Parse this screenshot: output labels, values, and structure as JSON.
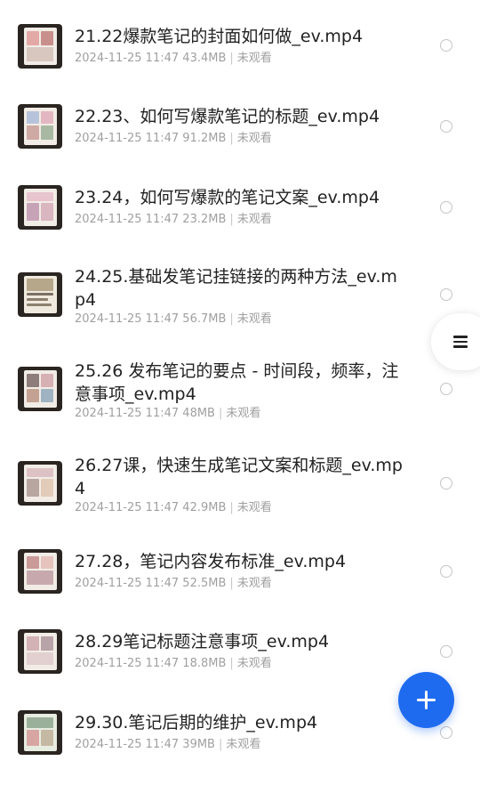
{
  "files": [
    {
      "name": "21.22爆款笔记的封面如何做_ev.mp4",
      "date": "2024-11-25 11:47",
      "size": "43.4MB",
      "status": "未观看"
    },
    {
      "name": "22.23、如何写爆款笔记的标题_ev.mp4",
      "date": "2024-11-25 11:47",
      "size": "91.2MB",
      "status": "未观看"
    },
    {
      "name": "23.24，如何写爆款的笔记文案_ev.mp4",
      "date": "2024-11-25 11:47",
      "size": "23.2MB",
      "status": "未观看"
    },
    {
      "name": "24.25.基础发笔记挂链接的两种方法_ev.mp4",
      "date": "2024-11-25 11:47",
      "size": "56.7MB",
      "status": "未观看"
    },
    {
      "name": "25.26 发布笔记的要点 - 时间段，频率，注意事项_ev.mp4",
      "date": "2024-11-25 11:47",
      "size": "48MB",
      "status": "未观看"
    },
    {
      "name": "26.27课，快速生成笔记文案和标题_ev.mp4",
      "date": "2024-11-25 11:47",
      "size": "42.9MB",
      "status": "未观看"
    },
    {
      "name": "27.28，笔记内容发布标准_ev.mp4",
      "date": "2024-11-25 11:47",
      "size": "52.5MB",
      "status": "未观看"
    },
    {
      "name": "28.29笔记标题注意事项_ev.mp4",
      "date": "2024-11-25 11:47",
      "size": "18.8MB",
      "status": "未观看"
    },
    {
      "name": "29.30.笔记后期的维护_ev.mp4",
      "date": "2024-11-25 11:47",
      "size": "39MB",
      "status": "未观看"
    }
  ],
  "icons": {
    "side_handle": "menu-icon",
    "fab": "plus-icon",
    "row_select": "radio-circle-icon",
    "thumbnail": "video-thumbnail"
  },
  "colors": {
    "accent": "#1f6bf0",
    "title_text": "#222222",
    "meta_text": "#a0a0a0"
  }
}
